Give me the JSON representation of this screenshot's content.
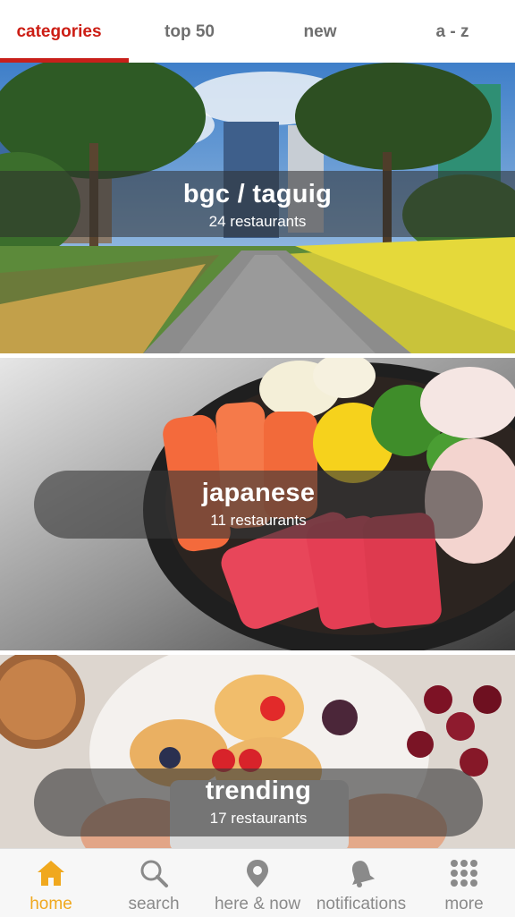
{
  "tabs": [
    {
      "label": "categories",
      "active": true
    },
    {
      "label": "top 50",
      "active": false
    },
    {
      "label": "new",
      "active": false
    },
    {
      "label": "a - z",
      "active": false
    }
  ],
  "categories": [
    {
      "title": "bgc / taguig",
      "count": "24 restaurants",
      "image": "city park walkway with trees and towers"
    },
    {
      "title": "japanese",
      "count": "11 restaurants",
      "image": "sashimi platter"
    },
    {
      "title": "trending",
      "count": "17 restaurants",
      "image": "pancakes, fruit and coffee photographed with phone"
    }
  ],
  "bottom_nav": [
    {
      "label": "home",
      "icon": "house-icon",
      "active": true
    },
    {
      "label": "search",
      "icon": "magnifier-icon",
      "active": false
    },
    {
      "label": "here & now",
      "icon": "location-pin-icon",
      "active": false
    },
    {
      "label": "notifications",
      "icon": "bell-icon",
      "active": false
    },
    {
      "label": "more",
      "icon": "grid-dots-icon",
      "active": false
    }
  ],
  "colors": {
    "accent": "#cc1d14",
    "nav_active": "#f0a81e",
    "nav_inactive": "#8a8a8a"
  }
}
